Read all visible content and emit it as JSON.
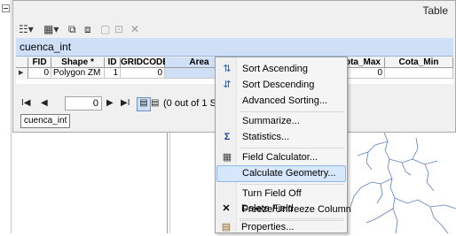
{
  "window": {
    "title": "Table"
  },
  "layer": {
    "name": "cuenca_int"
  },
  "grid": {
    "columns": [
      "FID",
      "Shape *",
      "ID",
      "GRIDCODE",
      "Area",
      "Cota_Max",
      "Cota_Min"
    ],
    "rows": [
      [
        "0",
        "Polygon ZM",
        "1",
        "0",
        "",
        "0",
        ""
      ]
    ]
  },
  "nav": {
    "current": "0",
    "first": "I◀",
    "prev": "◀",
    "next": "▶",
    "last": "▶I",
    "selection_text": "(0 out of 1 Select"
  },
  "tab": {
    "label": "cuenca_int"
  },
  "menu": {
    "items": [
      {
        "label": "Sort Ascending",
        "icon": "sort-ascending-icon"
      },
      {
        "label": "Sort Descending",
        "icon": "sort-descending-icon"
      },
      {
        "label": "Advanced Sorting...",
        "icon": ""
      },
      {
        "label": "Summarize...",
        "icon": ""
      },
      {
        "label": "Statistics...",
        "icon": "sigma-icon"
      },
      {
        "label": "Field Calculator...",
        "icon": "calculator-icon"
      },
      {
        "label": "Calculate Geometry...",
        "icon": ""
      },
      {
        "label": "Turn Field Off",
        "icon": ""
      },
      {
        "label": "Freeze/Unfreeze Column",
        "icon": ""
      },
      {
        "label": "Delete Field",
        "icon": "delete-x-icon"
      },
      {
        "label": "Properties...",
        "icon": "properties-icon"
      }
    ],
    "highlighted": "Calculate Geometry..."
  },
  "colors": {
    "header_selected": "#cfe0f6",
    "menu_highlight": "#d7e7fb",
    "map_river": "#5b7fc0"
  }
}
